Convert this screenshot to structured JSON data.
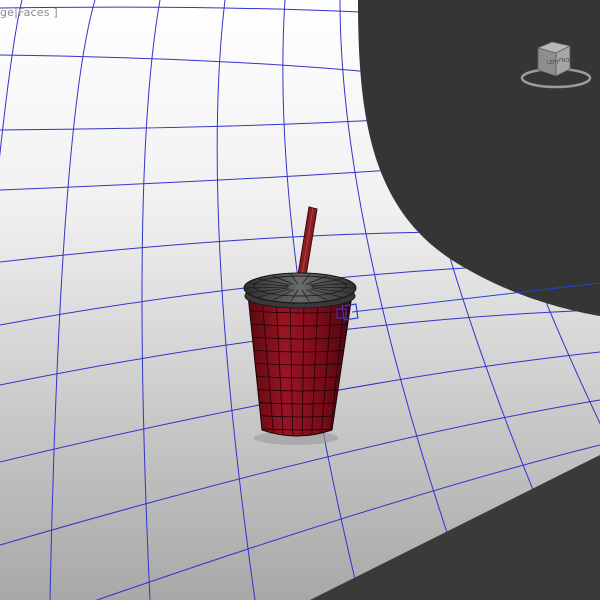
{
  "viewport": {
    "label": "ge|Faces ]",
    "background": "#353535"
  },
  "viewcube": {
    "left_face": "LEFT",
    "front_face": "FRONT",
    "icon": "viewcube-icon"
  },
  "scene": {
    "backdrop_color": "#d8d8d8",
    "wireframe_color": "#3333cc",
    "cup_color": "#8a0f1c",
    "lid_color": "#4a4a4a",
    "straw_color": "#8a1c22",
    "selection_color": "#2a3fd6"
  }
}
